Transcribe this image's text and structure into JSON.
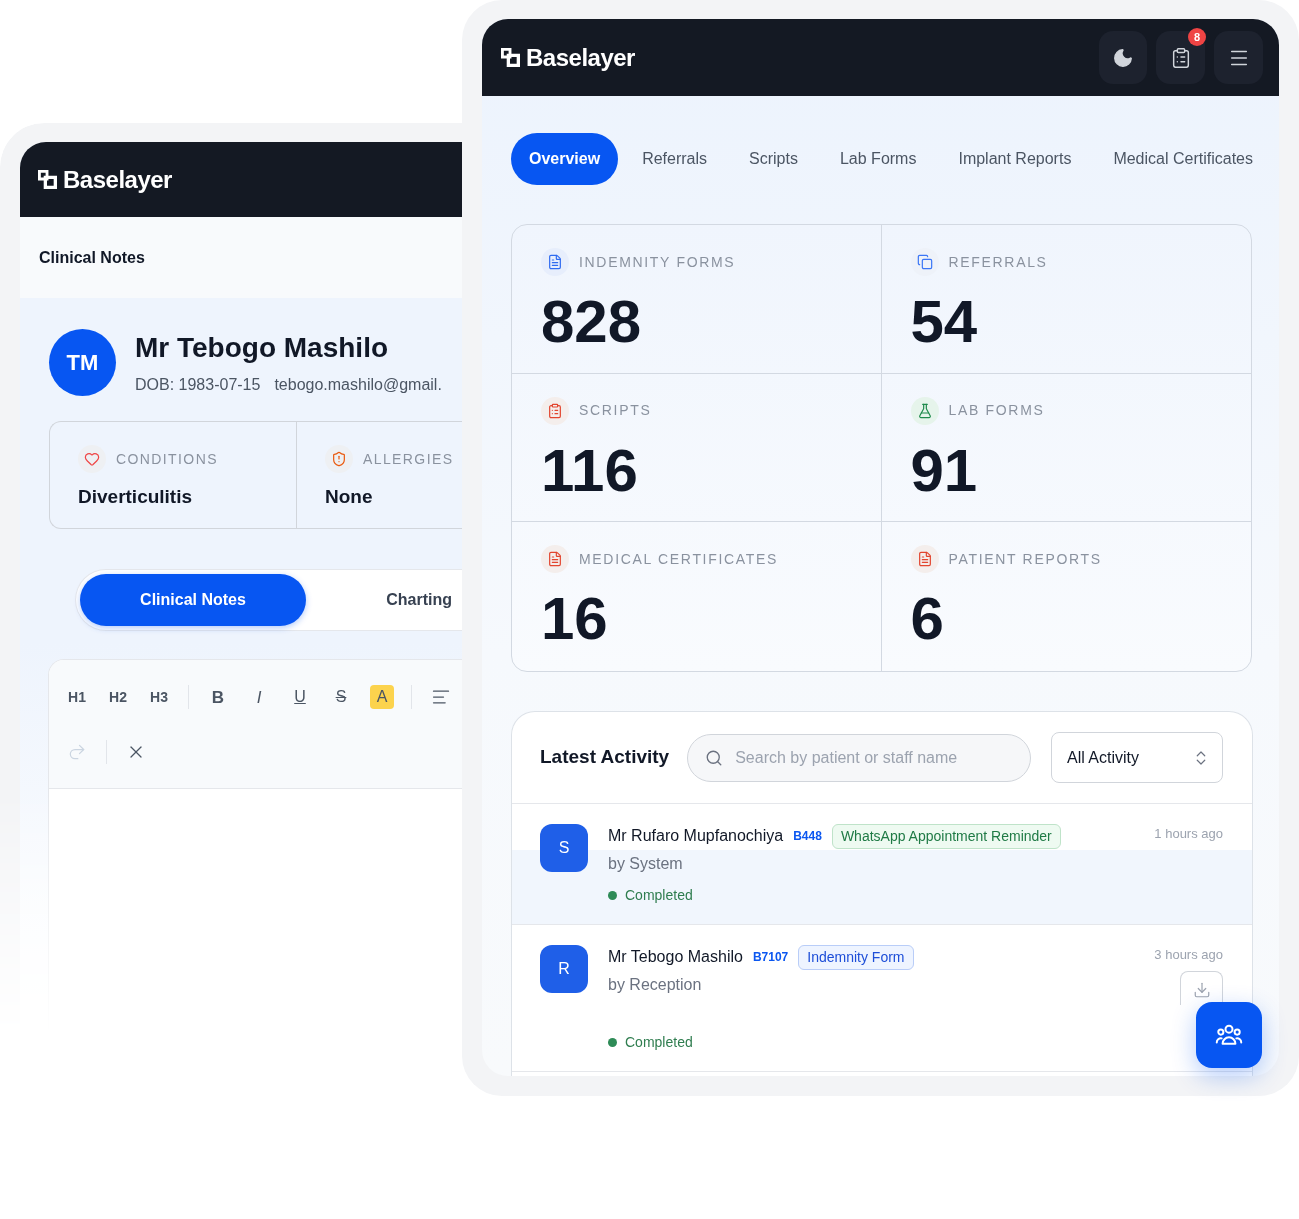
{
  "back_window": {
    "logo": "Baselayer",
    "page_title": "Clinical Notes",
    "patient": {
      "initials": "TM",
      "name": "Mr Tebogo Mashilo",
      "dob": "DOB: 1983-07-15",
      "email": "tebogo.mashilo@gmail."
    },
    "summary": [
      {
        "kind": "heart",
        "label": "CONDITIONS",
        "value": "Diverticulitis"
      },
      {
        "kind": "shield",
        "label": "ALLERGIES",
        "value": "None"
      }
    ],
    "tabs": [
      {
        "label": "Clinical Notes",
        "selected": true
      },
      {
        "label": "Charting",
        "selected": false
      }
    ],
    "toolbar": [
      [
        [
          {
            "kind": "heading",
            "label": "H1",
            "active": false,
            "disabled": false
          },
          {
            "kind": "heading",
            "label": "H2",
            "active": false,
            "disabled": false
          },
          {
            "kind": "heading",
            "label": "H3",
            "active": false,
            "disabled": false
          }
        ],
        [
          {
            "kind": "bold",
            "label": "B",
            "active": false,
            "disabled": false
          },
          {
            "kind": "italic",
            "label": "I",
            "active": false,
            "disabled": false
          },
          {
            "kind": "underline",
            "label": "U",
            "active": false,
            "disabled": false
          },
          {
            "kind": "strike",
            "label": "S",
            "active": false,
            "disabled": false
          },
          {
            "kind": "highlight",
            "label": "A",
            "active": true,
            "disabled": false
          }
        ],
        [
          {
            "kind": "align",
            "active": false,
            "disabled": false
          }
        ]
      ],
      [
        [
          {
            "kind": "redo",
            "active": false,
            "disabled": true
          }
        ],
        [
          {
            "kind": "clear",
            "active": false,
            "disabled": false
          }
        ]
      ]
    ]
  },
  "front_window": {
    "logo": "Baselayer",
    "notification_count": "8",
    "tabs": [
      {
        "label": "Overview",
        "selected": true
      },
      {
        "label": "Referrals",
        "selected": false
      },
      {
        "label": "Scripts",
        "selected": false
      },
      {
        "label": "Lab Forms",
        "selected": false
      },
      {
        "label": "Implant Reports",
        "selected": false
      },
      {
        "label": "Medical Certificates",
        "selected": false
      }
    ],
    "stats": [
      {
        "kind": "document",
        "label": "INDEMNITY FORMS",
        "value": "828"
      },
      {
        "kind": "copies",
        "label": "REFERRALS",
        "value": "54"
      },
      {
        "kind": "clipboard",
        "label": "SCRIPTS",
        "value": "116"
      },
      {
        "kind": "flask",
        "label": "LAB FORMS",
        "value": "91"
      },
      {
        "kind": "report",
        "label": "MEDICAL CERTIFICATES",
        "value": "16"
      },
      {
        "kind": "report",
        "label": "PATIENT REPORTS",
        "value": "6"
      }
    ],
    "activity": {
      "title": "Latest Activity",
      "search": {
        "placeholder": "Search by patient or staff name"
      },
      "filter": "All Activity",
      "rows": [
        {
          "initial": "S",
          "name": "Mr Rufaro Mupfanochiya",
          "code": "B448",
          "tag": {
            "kind": "reminder",
            "label": "WhatsApp Appointment Reminder"
          },
          "time": "1 hours ago",
          "by": "by System",
          "status": "Completed",
          "download": false
        },
        {
          "initial": "R",
          "name": "Mr Tebogo Mashilo",
          "code": "B7107",
          "tag": {
            "kind": "form",
            "label": "Indemnity Form"
          },
          "time": "3 hours ago",
          "by": "by Reception",
          "status": "Completed",
          "download": true
        }
      ]
    }
  }
}
